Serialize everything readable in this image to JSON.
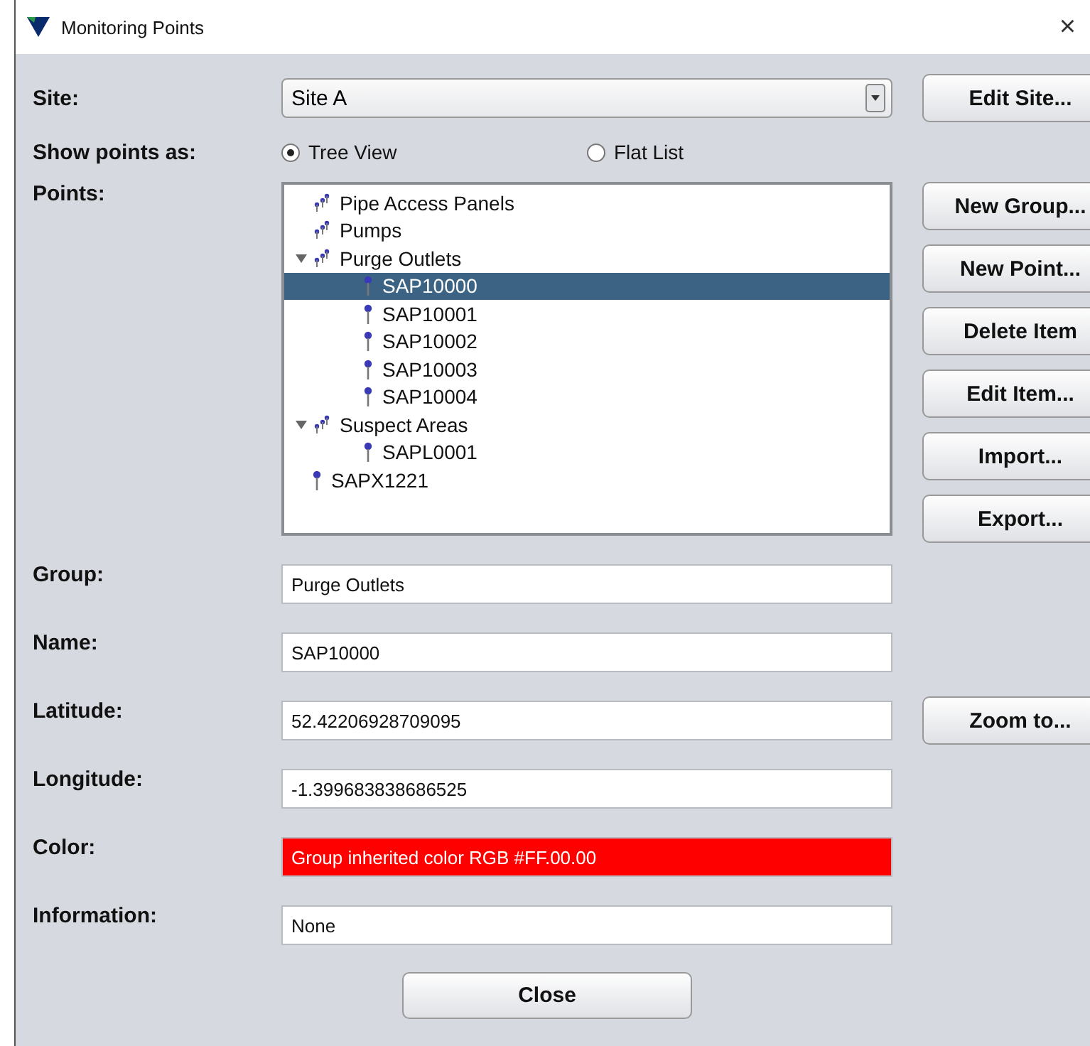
{
  "window": {
    "title": "Monitoring Points",
    "close": "×"
  },
  "site": {
    "label": "Site:",
    "value": "Site A",
    "button": "Edit Site..."
  },
  "show_points": {
    "label": "Show points as:",
    "options": [
      {
        "label": "Tree View",
        "selected": true
      },
      {
        "label": "Flat List",
        "selected": false
      }
    ]
  },
  "points": {
    "label": "Points:",
    "tree": [
      {
        "kind": "group",
        "label": "Pipe Access Panels",
        "selected": false
      },
      {
        "kind": "group",
        "label": "Pumps",
        "selected": false
      },
      {
        "kind": "group",
        "label": "Purge Outlets",
        "expanded": true,
        "selected": false,
        "children": [
          {
            "kind": "point",
            "label": "SAP10000",
            "selected": true
          },
          {
            "kind": "point",
            "label": "SAP10001",
            "selected": false
          },
          {
            "kind": "point",
            "label": "SAP10002",
            "selected": false
          },
          {
            "kind": "point",
            "label": "SAP10003",
            "selected": false
          },
          {
            "kind": "point",
            "label": "SAP10004",
            "selected": false
          }
        ]
      },
      {
        "kind": "group",
        "label": "Suspect Areas",
        "expanded": true,
        "selected": false,
        "children": [
          {
            "kind": "point",
            "label": "SAPL0001",
            "selected": false
          }
        ]
      },
      {
        "kind": "point",
        "label": "SAPX1221",
        "selected": false
      }
    ]
  },
  "tree_buttons": [
    "New Group...",
    "New Point...",
    "Delete Item",
    "Edit Item...",
    "Import...",
    "Export..."
  ],
  "fields": [
    {
      "label": "Group:",
      "value": "Purge Outlets"
    },
    {
      "label": "Name:",
      "value": "SAP10000"
    },
    {
      "label": "Latitude:",
      "value": "52.42206928709095",
      "button": "Zoom to..."
    },
    {
      "label": "Longitude:",
      "value": "-1.399683838686525"
    },
    {
      "label": "Color:",
      "value": "Group inherited color RGB #FF.00.00",
      "color": "#ff0000"
    },
    {
      "label": "Information:",
      "value": "None"
    }
  ],
  "close_button": "Close"
}
